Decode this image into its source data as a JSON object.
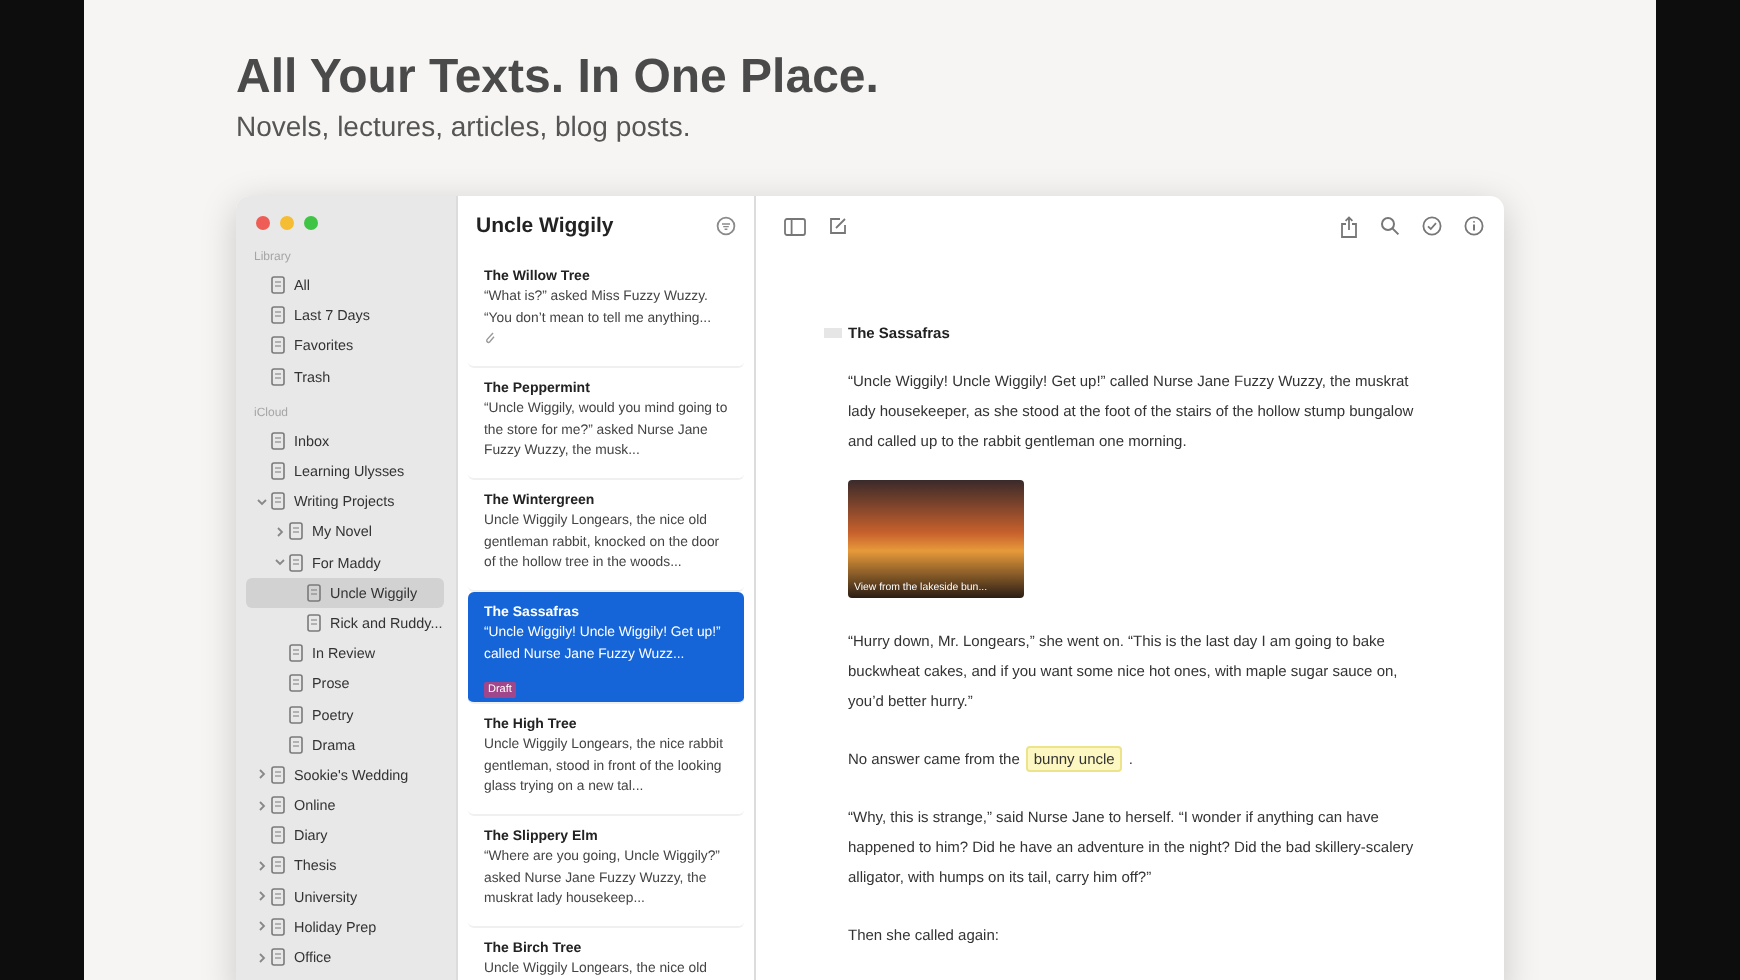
{
  "hero": {
    "title": "All Your Texts. In One Place.",
    "subtitle": "Novels, lectures, articles, blog posts."
  },
  "sidebar": {
    "sections": [
      {
        "heading": "Library",
        "items": [
          {
            "label": "All",
            "selected": false
          },
          {
            "label": "Last 7 Days",
            "selected": false
          },
          {
            "label": "Favorites",
            "selected": false
          },
          {
            "label": "Trash",
            "selected": false
          }
        ]
      },
      {
        "heading": "iCloud",
        "items": [
          {
            "label": "Inbox",
            "selected": false
          },
          {
            "label": "Learning Ulysses",
            "selected": false
          },
          {
            "label": "Writing Projects",
            "selected": false,
            "expanded": true,
            "children": [
              {
                "label": "My Novel",
                "selected": false,
                "expanded": false
              },
              {
                "label": "For Maddy",
                "selected": false,
                "expanded": true,
                "children": [
                  {
                    "label": "Uncle Wiggily",
                    "selected": true
                  },
                  {
                    "label": "Rick and Ruddy...",
                    "selected": false
                  }
                ]
              },
              {
                "label": "In Review",
                "selected": false
              },
              {
                "label": "Prose",
                "selected": false
              },
              {
                "label": "Poetry",
                "selected": false
              },
              {
                "label": "Drama",
                "selected": false
              }
            ]
          },
          {
            "label": "Sookie's Wedding",
            "selected": false,
            "expanded": false
          },
          {
            "label": "Online",
            "selected": false,
            "expanded": false
          },
          {
            "label": "Diary",
            "selected": false
          },
          {
            "label": "Thesis",
            "selected": false,
            "expanded": false
          },
          {
            "label": "University",
            "selected": false,
            "expanded": false
          },
          {
            "label": "Holiday Prep",
            "selected": false,
            "expanded": false
          },
          {
            "label": "Office",
            "selected": false,
            "expanded": false
          }
        ]
      }
    ]
  },
  "sheet_list": {
    "title": "Uncle Wiggily",
    "sheets": [
      {
        "title": "The Willow Tree",
        "excerpt": "“What is?” asked Miss Fuzzy Wuzzy. “You don’t mean to tell me anything...",
        "attachment": true,
        "selected": false
      },
      {
        "title": "The Peppermint",
        "excerpt": "“Uncle Wiggily, would you mind going to the store for me?” asked Nurse Jane Fuzzy Wuzzy, the musk...",
        "attachment": false,
        "selected": false
      },
      {
        "title": "The Wintergreen",
        "excerpt": "Uncle Wiggily Longears, the nice old gentleman rabbit, knocked on the door of the hollow tree in the woods...",
        "attachment": false,
        "selected": false
      },
      {
        "title": "The Sassafras",
        "excerpt": "“Uncle Wiggily! Uncle Wiggily! Get up!” called Nurse Jane Fuzzy Wuzz...",
        "badge": "Draft",
        "attachment": false,
        "selected": true
      },
      {
        "title": "The High Tree",
        "excerpt": "Uncle Wiggily Longears, the nice rabbit gentleman, stood in front of the looking glass trying on a new tal...",
        "attachment": false,
        "selected": false
      },
      {
        "title": "The Slippery Elm",
        "excerpt": "“Where are you going, Uncle Wiggily?” asked Nurse Jane Fuzzy Wuzzy, the muskrat lady housekeep...",
        "attachment": false,
        "selected": false
      },
      {
        "title": "The Birch Tree",
        "excerpt": "Uncle Wiggily Longears, the nice old",
        "attachment": false,
        "selected": false
      }
    ]
  },
  "editor": {
    "heading": "The Sassafras",
    "blocks": [
      {
        "kind": "paragraph",
        "text": "“Uncle Wiggily! Uncle Wiggily! Get up!” called Nurse Jane Fuzzy Wuzzy, the muskrat lady housekeeper, as she stood at the foot of the stairs of the hollow stump bungalow and called up to the rabbit gentleman one morning."
      },
      {
        "kind": "image",
        "caption": "View from the lakeside bun..."
      },
      {
        "kind": "paragraph",
        "text": "“Hurry down, Mr. Longears,” she went on. “This is the last day I am going to bake buckwheat cakes, and if you want some nice hot ones, with maple sugar sauce on, you’d better hurry.”"
      },
      {
        "kind": "annotated",
        "before": "No answer came from the",
        "highlight": "bunny uncle",
        "after": "."
      },
      {
        "kind": "paragraph",
        "text": "“Why, this is strange,” said Nurse Jane to herself. “I wonder if anything can have happened to him? Did he have an adventure in the night? Did the bad skillery-scalery alligator, with humps on its tail, carry him off?”"
      },
      {
        "kind": "paragraph",
        "text": "Then she called again:"
      }
    ]
  }
}
